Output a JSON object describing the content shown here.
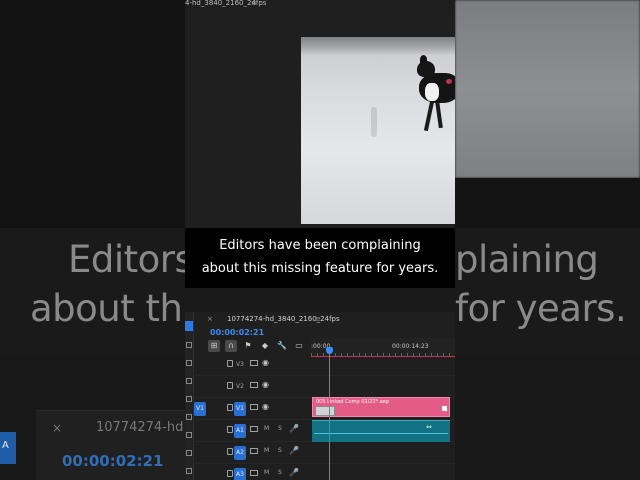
{
  "caption": {
    "line1": "Editors have been complaining",
    "line2": "about this missing feature for years."
  },
  "background_echo": {
    "line1_left": "Editors",
    "line1_right": "plaining",
    "line2_left": "about this",
    "line2_right": "for years.",
    "sequence_name": "10774274-hd",
    "timecode": "00:00:02:21",
    "close_glyph": "×",
    "tab_label": "A"
  },
  "program_monitor": {
    "title": "4-hd_3840_2160_24fps",
    "menu_glyph": "≡"
  },
  "timeline": {
    "close_glyph": "×",
    "sequence_name": "10774274-hd_3840_2160_24fps",
    "menu_glyph": "≡",
    "timecode": "00:00:02:21",
    "ruler": {
      "start": ":00:00",
      "mark": "00:00:14:23"
    },
    "tools": [
      {
        "name": "insert-nest-icon",
        "glyph": "⊞"
      },
      {
        "name": "snap-magnet-icon",
        "glyph": "∩"
      },
      {
        "name": "linked-selection-icon",
        "glyph": "⚑"
      },
      {
        "name": "add-marker-icon",
        "glyph": "◆"
      },
      {
        "name": "wrench-icon",
        "glyph": "🔧"
      },
      {
        "name": "captions-icon",
        "glyph": "▭"
      }
    ],
    "tracks": [
      {
        "id": "V3",
        "kind": "video",
        "src": "",
        "eye": "◉"
      },
      {
        "id": "V2",
        "kind": "video",
        "src": "",
        "eye": "◉"
      },
      {
        "id": "V1",
        "kind": "video",
        "src": "V1",
        "eye": "◉"
      },
      {
        "id": "A1",
        "kind": "audio",
        "src": "",
        "m": "M",
        "s": "S",
        "mic": "🎤"
      },
      {
        "id": "A2",
        "kind": "audio",
        "src": "",
        "m": "M",
        "s": "S",
        "mic": "🎤"
      },
      {
        "id": "A3",
        "kind": "audio",
        "src": "",
        "m": "M",
        "s": "S",
        "mic": "🎤"
      }
    ],
    "video_clip_label": "005 Linked Comp 02/22*.aep",
    "audio_clip_icon": "⇔"
  },
  "colors": {
    "accent_blue": "#2a6fd3",
    "video_clip": "#e45b88",
    "audio_clip": "#127182",
    "ruler_red": "#c0354f"
  }
}
